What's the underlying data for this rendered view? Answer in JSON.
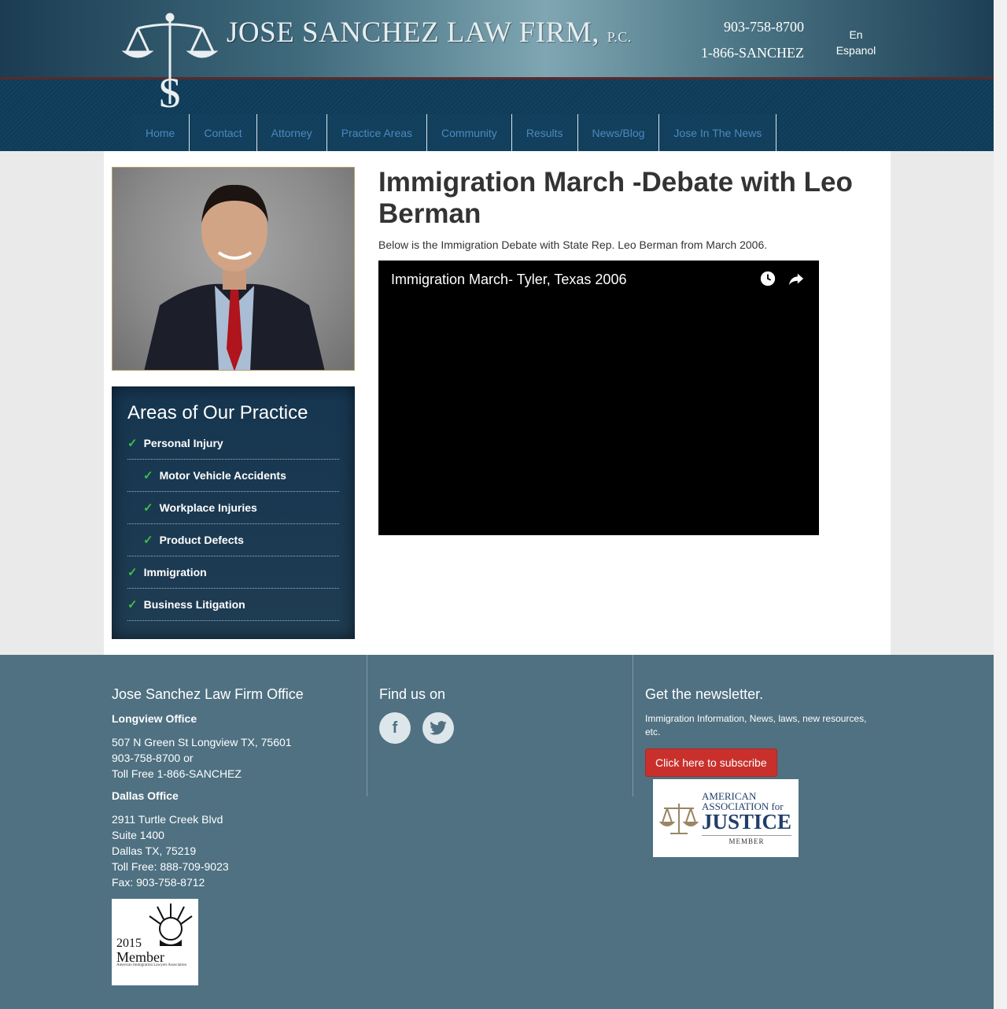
{
  "header": {
    "firm_name": "JOSE SANCHEZ LAW FIRM",
    "firm_suffix": "P.C.",
    "phone_local": "903-758-8700",
    "phone_toll": "1-866-SANCHEZ",
    "lang_en": "En",
    "lang_es": "Espanol"
  },
  "nav": {
    "items": [
      "Home",
      "Contact",
      "Attorney",
      "Practice Areas",
      "Community",
      "Results",
      "News/Blog",
      "Jose In The News"
    ]
  },
  "sidebar": {
    "practice_title": "Areas of Our Practice",
    "practice_items": [
      {
        "label": "Personal Injury",
        "sub": false
      },
      {
        "label": "Motor Vehicle Accidents",
        "sub": true
      },
      {
        "label": "Workplace Injuries",
        "sub": true
      },
      {
        "label": "Product Defects",
        "sub": true
      },
      {
        "label": "Immigration",
        "sub": false
      },
      {
        "label": "Business Litigation",
        "sub": false
      }
    ]
  },
  "post": {
    "title": "Immigration March -Debate with Leo Berman",
    "intro": "Below is the Immigration Debate with State Rep. Leo Berman from March 2006.",
    "video_title": "Immigration March- Tyler, Texas 2006"
  },
  "footer": {
    "office_heading": "Jose Sanchez Law Firm Office",
    "longview_title": "Longview Office",
    "longview_address": "507 N Green St Longview TX, 75601",
    "longview_phone": "903-758-8700 or",
    "longview_toll": "Toll Free 1-866-SANCHEZ",
    "dallas_title": "Dallas Office",
    "dallas_street": "2911 Turtle Creek Blvd",
    "dallas_suite": "Suite 1400",
    "dallas_city": "Dallas TX, 75219",
    "dallas_toll": "Toll Free: 888-709-9023",
    "dallas_fax": "Fax: 903-758-8712",
    "find_heading": "Find us on",
    "newsletter_heading": "Get the newsletter.",
    "newsletter_desc": "Immigration Information, News, laws, new resources, etc.",
    "subscribe_label": "Click here to subscribe",
    "aaj_line1": "AMERICAN",
    "aaj_line2": "ASSOCIATION for",
    "aaj_line3": "JUSTICE",
    "aaj_member": "MEMBER",
    "aila_year": "2015",
    "aila_member": "Member",
    "aila_org": "American Immigration Lawyers Association"
  },
  "colors": {
    "nav_text": "#4f88bf",
    "footer_bg": "#4f7182",
    "practice_bg": "#163650",
    "check": "#3bbf4a",
    "subscribe_bg": "#c9302c"
  }
}
